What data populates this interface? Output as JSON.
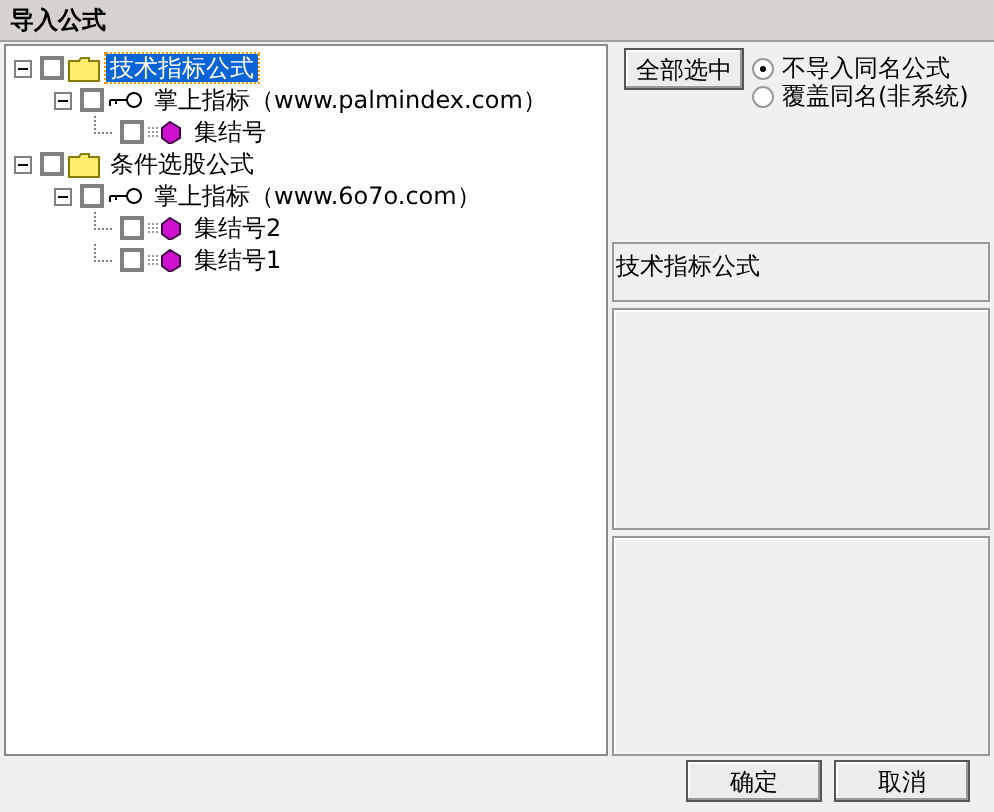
{
  "window": {
    "title": "导入公式"
  },
  "tree": [
    {
      "label": "技术指标公式",
      "kind": "folder",
      "checked": false,
      "expanded": true,
      "selected": true,
      "children": [
        {
          "label": "掌上指标（www.palmindex.com）",
          "kind": "group",
          "checked": false,
          "expanded": true,
          "selected": false,
          "children": [
            {
              "label": "集结号",
              "kind": "formula",
              "checked": false,
              "selected": false
            }
          ]
        }
      ]
    },
    {
      "label": "条件选股公式",
      "kind": "folder",
      "checked": false,
      "expanded": true,
      "selected": false,
      "children": [
        {
          "label": "掌上指标（www.6o7o.com）",
          "kind": "group",
          "checked": false,
          "expanded": true,
          "selected": false,
          "children": [
            {
              "label": "集结号2",
              "kind": "formula",
              "checked": false,
              "selected": false
            },
            {
              "label": "集结号1",
              "kind": "formula",
              "checked": false,
              "selected": false
            }
          ]
        }
      ]
    }
  ],
  "select_all_button": "全部选中",
  "options": [
    {
      "label": "不导入同名公式",
      "selected": true
    },
    {
      "label": "覆盖同名(非系统)",
      "selected": false
    }
  ],
  "info_label": "技术指标公式",
  "buttons": [
    "确定",
    "取消"
  ]
}
